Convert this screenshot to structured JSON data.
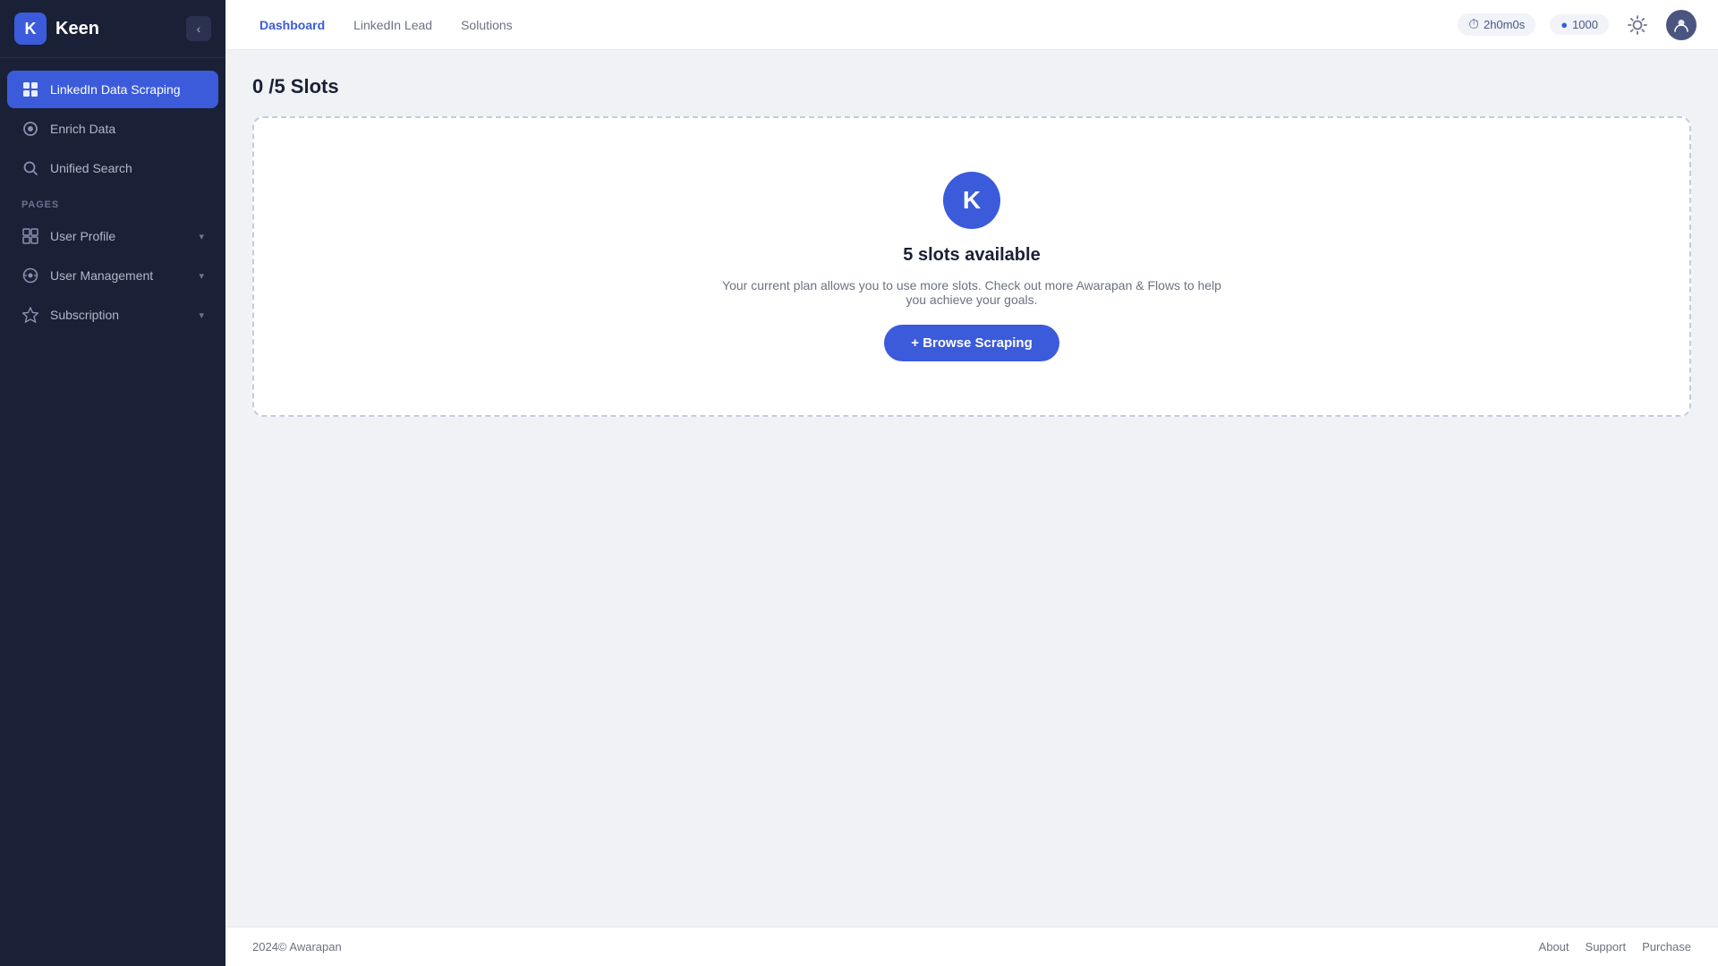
{
  "brand": {
    "logo_letter": "K",
    "name": "Keen"
  },
  "sidebar": {
    "collapse_icon": "‹",
    "nav_items": [
      {
        "id": "linkedin-data-scraping",
        "label": "LinkedIn Data Scraping",
        "icon": "▦",
        "active": true
      },
      {
        "id": "enrich-data",
        "label": "Enrich Data",
        "icon": "◉",
        "active": false
      },
      {
        "id": "unified-search",
        "label": "Unified Search",
        "icon": "◉",
        "active": false
      }
    ],
    "pages_label": "PAGES",
    "page_items": [
      {
        "id": "user-profile",
        "label": "User Profile",
        "icon": "👤",
        "has_chevron": true
      },
      {
        "id": "user-management",
        "label": "User Management",
        "icon": "⚙",
        "has_chevron": true
      },
      {
        "id": "subscription",
        "label": "Subscription",
        "icon": "✦",
        "has_chevron": true
      }
    ]
  },
  "topnav": {
    "tabs": [
      {
        "id": "dashboard",
        "label": "Dashboard",
        "active": true
      },
      {
        "id": "linkedin-lead",
        "label": "LinkedIn Lead",
        "active": false
      },
      {
        "id": "solutions",
        "label": "Solutions",
        "active": false
      }
    ],
    "timer": {
      "icon": "⏱",
      "value": "2h0m0s"
    },
    "credits": {
      "icon": "🔵",
      "value": "1000"
    }
  },
  "main": {
    "slots_title": "0 /5 Slots",
    "card": {
      "logo_letter": "K",
      "slots_available": "5 slots available",
      "description": "Your current plan allows you to use more slots. Check out more Awarapan & Flows to help you achieve your goals.",
      "browse_button": "+ Browse Scraping"
    }
  },
  "footer": {
    "copyright": "2024© Awarapan",
    "links": [
      "About",
      "Support",
      "Purchase"
    ]
  }
}
